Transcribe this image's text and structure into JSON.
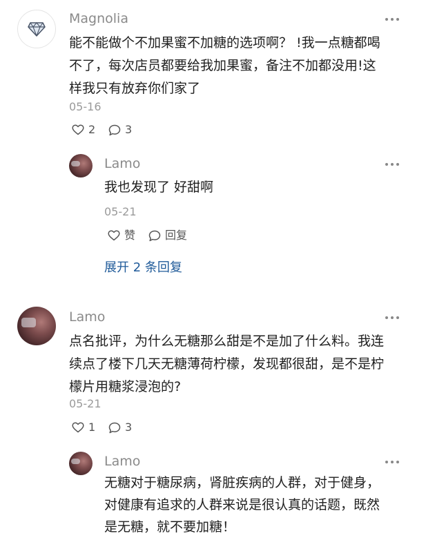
{
  "comments": [
    {
      "username": "Magnolia",
      "avatar_icon": "diamond-icon",
      "lines": [
        "能不能做个不加果蜜不加糖的选项啊？ !我一点糖都喝",
        "不了，每次店员都要给我加果蜜，备注不加都没用!这",
        "样我只有放弃你们家了"
      ],
      "date": "05-16",
      "like_count": "2",
      "reply_count": "3",
      "reply": {
        "username": "Lamo",
        "lines": [
          "我也发现了 好甜啊"
        ],
        "date": "05-21",
        "like_label": "赞",
        "reply_label": "回复"
      },
      "expand_label": "展开 2 条回复"
    },
    {
      "username": "Lamo",
      "lines": [
        "点名批评，为什么无糖那么甜是不是加了什么料。我连",
        "续点了楼下几天无糖薄荷柠檬，发现都很甜，是不是柠",
        "檬片用糖浆浸泡的?"
      ],
      "date": "05-21",
      "like_count": "1",
      "reply_count": "3",
      "reply": {
        "username": "Lamo",
        "lines": [
          "无糖对于糖尿病，肾脏疾病的人群，对于健身，",
          "对健康有追求的人群来说是很认真的话题，既然",
          "是无糖，就不要加糖！"
        ]
      }
    }
  ],
  "colors": {
    "link": "#1f5a99",
    "username": "#8a8a8a",
    "meta": "#9a9a9a"
  }
}
